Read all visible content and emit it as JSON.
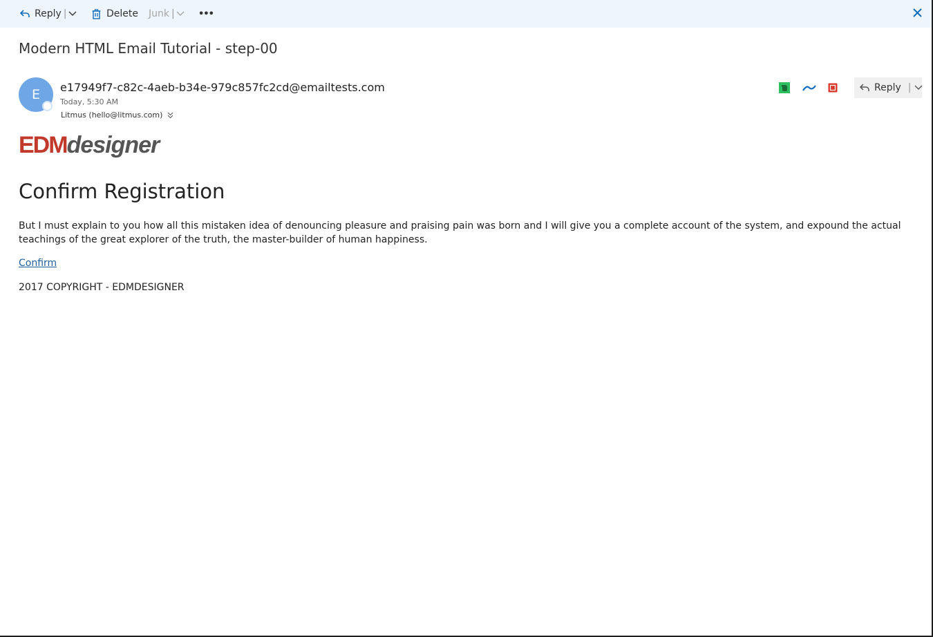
{
  "toolbar": {
    "reply_label": "Reply",
    "delete_label": "Delete",
    "junk_label": "Junk",
    "more_label": "•••",
    "close_label": "✕"
  },
  "message": {
    "subject": "Modern HTML Email Tutorial - step-00",
    "avatar_initial": "E",
    "sender_email": "e17949f7-c82c-4aeb-b34e-979c857fc2cd@emailtests.com",
    "sent_time": "Today, 5:30 AM",
    "recipient": "Litmus (hello@litmus.com)",
    "reply_label": "Reply"
  },
  "body": {
    "logo_edm": "EDM",
    "logo_designer": "designer",
    "headline": "Confirm Registration",
    "paragraph": "But I must explain to you how all this mistaken idea of denouncing pleasure and praising pain was born and I will give you a complete account of the system, and expound the actual teachings of the great explorer of the truth, the master-builder of human happiness.",
    "confirm_link": "Confirm",
    "copyright": "2017 COPYRIGHT - EDMDESIGNER"
  },
  "colors": {
    "accent": "#0f6cbd",
    "toolbar_bg": "#eef5fc",
    "avatar_bg": "#6fa6e6",
    "logo_red": "#c0392b",
    "logo_gray": "#555555",
    "evernote_green": "#2dbe60",
    "addin_red": "#d9362b"
  },
  "icons": {
    "reply": "reply-arrow-icon",
    "delete": "trash-icon",
    "more": "ellipsis-icon",
    "close": "close-icon",
    "expand": "double-chevron-down-icon"
  }
}
